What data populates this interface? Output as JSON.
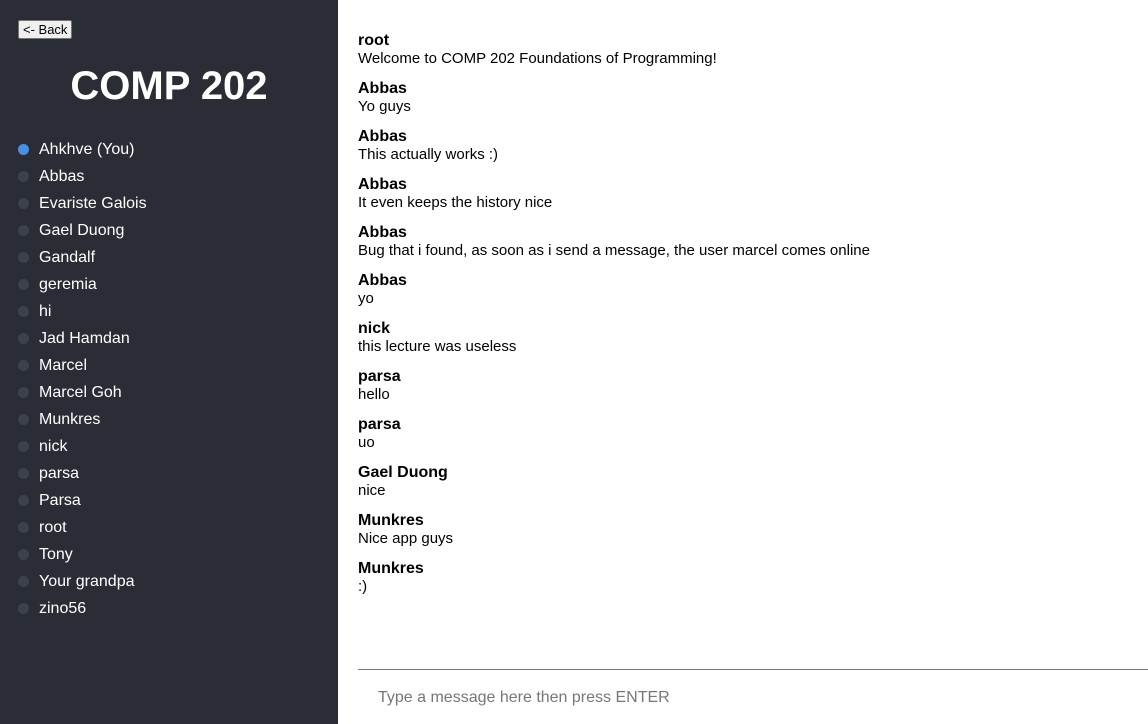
{
  "sidebar": {
    "back_label": "<- Back",
    "room_title": "COMP 202",
    "users": [
      {
        "name": "Ahkhve (You)",
        "online": true
      },
      {
        "name": "Abbas",
        "online": false
      },
      {
        "name": "Evariste Galois",
        "online": false
      },
      {
        "name": "Gael Duong",
        "online": false
      },
      {
        "name": "Gandalf",
        "online": false
      },
      {
        "name": "geremia",
        "online": false
      },
      {
        "name": "hi",
        "online": false
      },
      {
        "name": "Jad Hamdan",
        "online": false
      },
      {
        "name": "Marcel",
        "online": false
      },
      {
        "name": "Marcel Goh",
        "online": false
      },
      {
        "name": "Munkres",
        "online": false
      },
      {
        "name": "nick",
        "online": false
      },
      {
        "name": "parsa",
        "online": false
      },
      {
        "name": "Parsa",
        "online": false
      },
      {
        "name": "root",
        "online": false
      },
      {
        "name": "Tony",
        "online": false
      },
      {
        "name": "Your grandpa",
        "online": false
      },
      {
        "name": "zino56",
        "online": false
      }
    ],
    "status_colors": {
      "online": "#4a90e2",
      "offline": "#3d414a"
    }
  },
  "chat": {
    "messages": [
      {
        "author": "root",
        "text": "Welcome to COMP 202 Foundations of Programming!"
      },
      {
        "author": "Abbas",
        "text": "Yo guys"
      },
      {
        "author": "Abbas",
        "text": "This actually works :)"
      },
      {
        "author": "Abbas",
        "text": "It even keeps the history nice"
      },
      {
        "author": "Abbas",
        "text": "Bug that i found, as soon as i send a message, the user marcel comes online"
      },
      {
        "author": "Abbas",
        "text": "yo"
      },
      {
        "author": "nick",
        "text": "this lecture was useless"
      },
      {
        "author": "parsa",
        "text": "hello"
      },
      {
        "author": "parsa",
        "text": "uo"
      },
      {
        "author": "Gael Duong",
        "text": "nice"
      },
      {
        "author": "Munkres",
        "text": "Nice app guys"
      },
      {
        "author": "Munkres",
        "text": ":)"
      }
    ],
    "input": {
      "placeholder": "Type a message here then press ENTER",
      "value": ""
    }
  }
}
